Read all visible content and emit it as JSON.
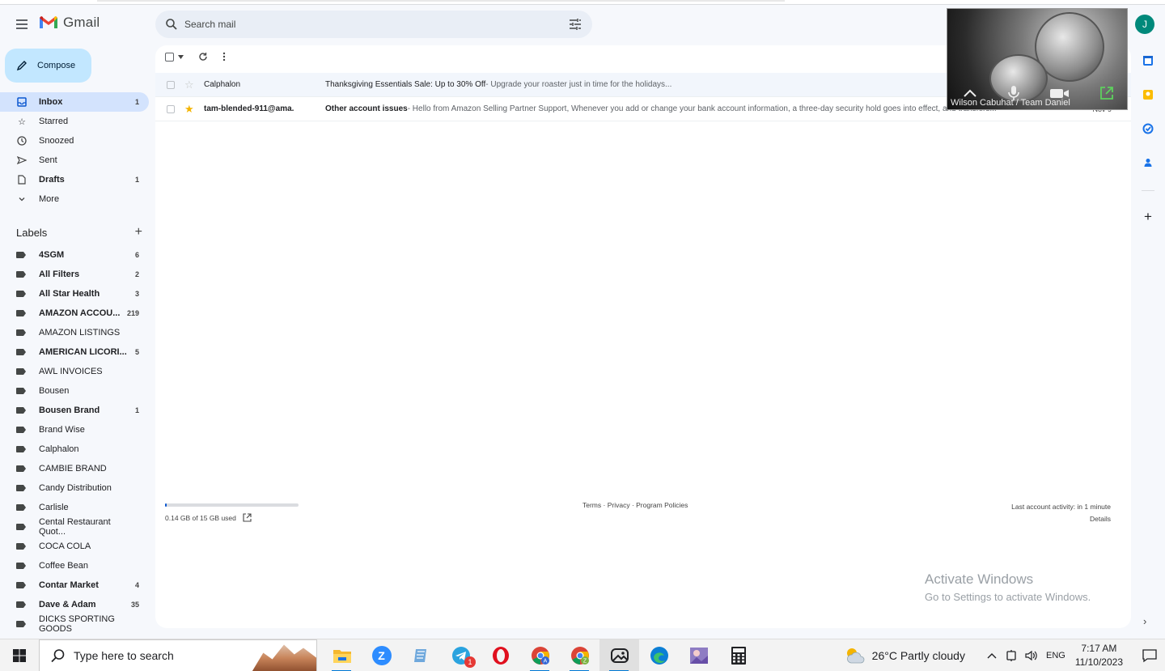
{
  "app": {
    "name": "Gmail"
  },
  "search": {
    "placeholder": "Search mail"
  },
  "compose": {
    "label": "Compose"
  },
  "nav": [
    {
      "label": "Inbox",
      "count": "1",
      "icon": "inbox-icon",
      "active": true
    },
    {
      "label": "Starred",
      "count": "",
      "icon": "star-icon"
    },
    {
      "label": "Snoozed",
      "count": "",
      "icon": "clock-icon"
    },
    {
      "label": "Sent",
      "count": "",
      "icon": "send-icon"
    },
    {
      "label": "Drafts",
      "count": "1",
      "icon": "draft-icon",
      "bold": true
    },
    {
      "label": "More",
      "count": "",
      "icon": "chevron-down-icon"
    }
  ],
  "labels_section": {
    "title": "Labels",
    "add_icon": "plus-icon"
  },
  "labels": [
    {
      "label": "4SGM",
      "count": "6",
      "bold": true
    },
    {
      "label": "All Filters",
      "count": "2",
      "bold": true
    },
    {
      "label": "All Star Health",
      "count": "3",
      "bold": true
    },
    {
      "label": "AMAZON ACCOU...",
      "count": "219",
      "bold": true
    },
    {
      "label": "AMAZON LISTINGS",
      "count": "",
      "bold": false
    },
    {
      "label": "AMERICAN LICORI...",
      "count": "5",
      "bold": true
    },
    {
      "label": "AWL INVOICES",
      "count": "",
      "bold": false
    },
    {
      "label": "Bousen",
      "count": "",
      "bold": false
    },
    {
      "label": "Bousen Brand",
      "count": "1",
      "bold": true
    },
    {
      "label": "Brand Wise",
      "count": "",
      "bold": false
    },
    {
      "label": "Calphalon",
      "count": "",
      "bold": false
    },
    {
      "label": "CAMBIE BRAND",
      "count": "",
      "bold": false
    },
    {
      "label": "Candy Distribution",
      "count": "",
      "bold": false
    },
    {
      "label": "Carlisle",
      "count": "",
      "bold": false
    },
    {
      "label": "Cental Restaurant Quot...",
      "count": "",
      "bold": false
    },
    {
      "label": "COCA COLA",
      "count": "",
      "bold": false
    },
    {
      "label": "Coffee Bean",
      "count": "",
      "bold": false
    },
    {
      "label": "Contar Market",
      "count": "4",
      "bold": true
    },
    {
      "label": "Dave & Adam",
      "count": "35",
      "bold": true
    },
    {
      "label": "DICKS SPORTING GOODS",
      "count": "",
      "bold": false
    }
  ],
  "emails": [
    {
      "sender": "Calphalon",
      "subject": "Thanksgiving Essentials Sale: Up to 30% Off",
      "snippet": " - Upgrade your roaster just in time for the holidays...",
      "date": "",
      "starred": false,
      "unread": false
    },
    {
      "sender": "tam-blended-911@ama.",
      "subject": "Other account issues",
      "snippet": " - Hello from Amazon Selling Partner Support, Whenever you add or change your bank account information, a three-day security hold goes into effect, and transfers...",
      "date": "Nov 9",
      "starred": true,
      "unread": true
    }
  ],
  "storage": {
    "used_text": "0.14 GB of 15 GB used",
    "fraction": 0.01
  },
  "footer": {
    "terms": "Terms",
    "sep1": " · ",
    "privacy": "Privacy",
    "sep2": " · ",
    "policies": "Program Policies"
  },
  "activity": {
    "text": "Last account activity: in 1 minute",
    "details": "Details"
  },
  "account": {
    "initial": "J"
  },
  "video": {
    "name": "Wilson Cabuhat / Team Daniel"
  },
  "activation": {
    "title": "Activate Windows",
    "subtitle": "Go to Settings to activate Windows."
  },
  "taskbar": {
    "search_placeholder": "Type here to search",
    "weather": "26°C  Partly cloudy",
    "lang": "ENG",
    "time": "7:17 AM",
    "date": "11/10/2023",
    "telegram_badge": "1"
  },
  "colors": {
    "accent": "#0b57d0",
    "compose": "#c2e7ff",
    "active_nav": "#d3e3fd",
    "star": "#f4b400"
  }
}
